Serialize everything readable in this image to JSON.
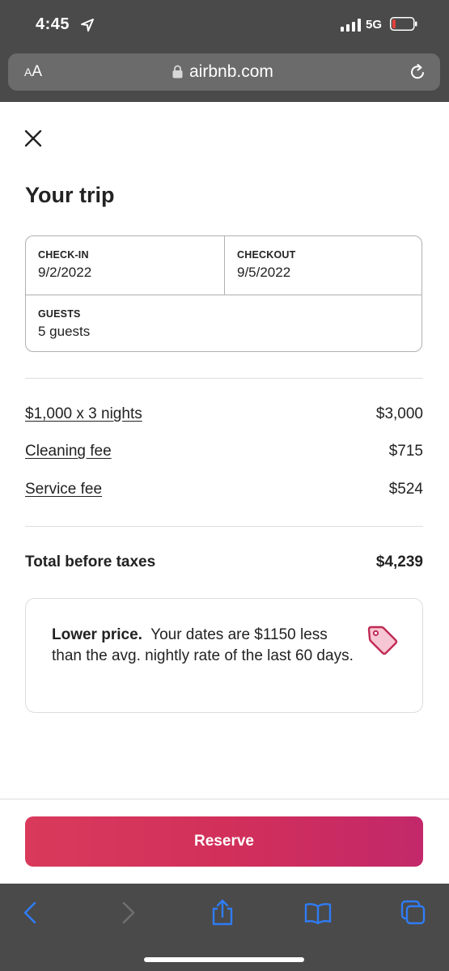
{
  "status_bar": {
    "time": "4:45",
    "network": "5G",
    "icons": [
      "location-arrow-icon",
      "signal-icon",
      "battery-icon"
    ]
  },
  "browser": {
    "text_size_label_small": "A",
    "text_size_label_large": "A",
    "url": "airbnb.com",
    "icons": [
      "lock-icon",
      "reload-icon"
    ]
  },
  "page": {
    "close_icon": "close-icon",
    "title": "Your trip",
    "checkin": {
      "label": "CHECK-IN",
      "value": "9/2/2022"
    },
    "checkout": {
      "label": "CHECKOUT",
      "value": "9/5/2022"
    },
    "guests": {
      "label": "GUESTS",
      "value": "5 guests"
    },
    "price_breakdown": [
      {
        "label": "$1,000 x 3 nights",
        "amount": "$3,000"
      },
      {
        "label": "Cleaning fee",
        "amount": "$715"
      },
      {
        "label": "Service fee",
        "amount": "$524"
      }
    ],
    "total": {
      "label": "Total before taxes",
      "amount": "$4,239"
    },
    "promo": {
      "headline": "Lower price.",
      "body": "Your dates are $1150 less than the avg. nightly rate of the last 60 days.",
      "icon": "price-tag-icon"
    },
    "reserve_label": "Reserve"
  },
  "toolbar": {
    "icons": [
      "back-icon",
      "forward-icon",
      "share-icon",
      "bookmarks-icon",
      "tabs-icon"
    ]
  },
  "colors": {
    "brand_gradient_start": "#d93a5b",
    "brand_gradient_end": "#c2286a",
    "ios_blue": "#2f7cf6",
    "chrome_gray": "#4a4a4a",
    "battery_low": "#e0413a"
  }
}
